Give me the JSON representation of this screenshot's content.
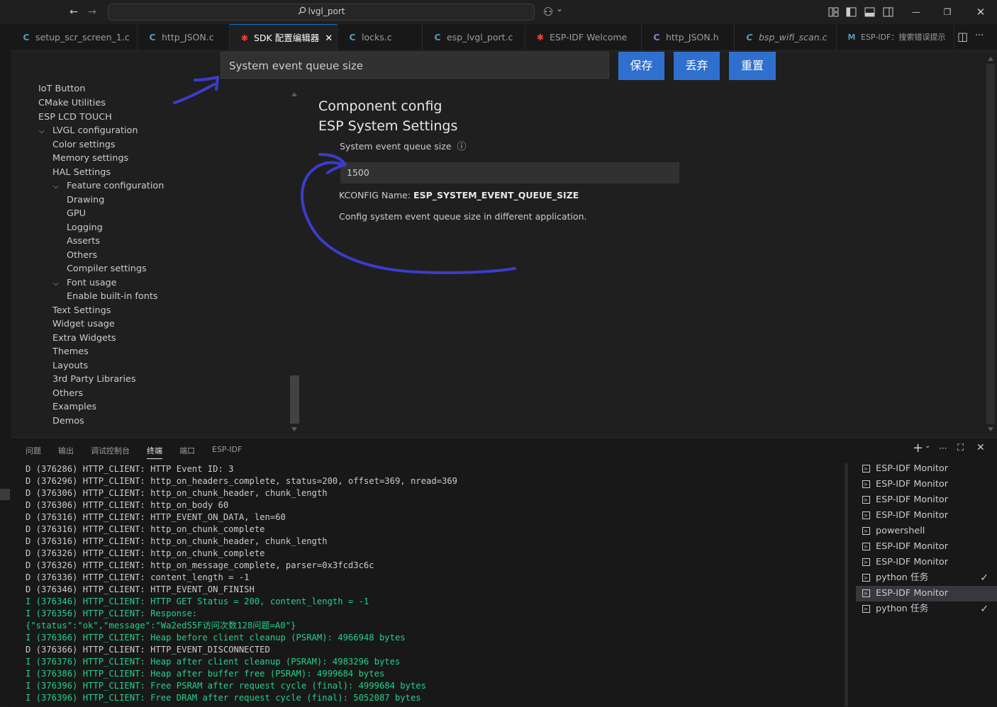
{
  "titlebar": {
    "back": "←",
    "forward": "→",
    "search_text": "lvgl_port",
    "copilot": "⚇",
    "copilot_chevron": "⌄",
    "minimize": "—",
    "restore": "❐",
    "close": "✕"
  },
  "tabs": [
    {
      "icon": "C",
      "label": "setup_scr_screen_1.c",
      "kind": "c"
    },
    {
      "icon": "C",
      "label": "http_JSON.c",
      "kind": "c"
    },
    {
      "icon": "✱",
      "label": "SDK 配置编辑器",
      "kind": "esp",
      "active": true,
      "close": "✕"
    },
    {
      "icon": "C",
      "label": "locks.c",
      "kind": "c"
    },
    {
      "icon": "C",
      "label": "esp_lvgl_port.c",
      "kind": "c"
    },
    {
      "icon": "✱",
      "label": "ESP-IDF Welcome",
      "kind": "esp"
    },
    {
      "icon": "C",
      "label": "http_JSON.h",
      "kind": "h"
    },
    {
      "icon": "C",
      "label": "bsp_wifi_scan.c",
      "kind": "c"
    },
    {
      "icon": "M",
      "label": "ESP-IDF：搜索错误提示",
      "kind": "m"
    }
  ],
  "tab_actions": {
    "split": "◫",
    "more": "···"
  },
  "config": {
    "search_value": "System event queue size",
    "buttons": {
      "save": "保存",
      "discard": "丢弃",
      "reset": "重置"
    },
    "tree": [
      {
        "label": "IoT Button",
        "indent": 0
      },
      {
        "label": "CMake Utilities",
        "indent": 0
      },
      {
        "label": "ESP LCD TOUCH",
        "indent": 0
      },
      {
        "label": "LVGL configuration",
        "indent": 1,
        "expanded": true
      },
      {
        "label": "Color settings",
        "indent": 1
      },
      {
        "label": "Memory settings",
        "indent": 1
      },
      {
        "label": "HAL Settings",
        "indent": 1
      },
      {
        "label": "Feature configuration",
        "indent": 2,
        "expanded": true
      },
      {
        "label": "Drawing",
        "indent": 2
      },
      {
        "label": "GPU",
        "indent": 2
      },
      {
        "label": "Logging",
        "indent": 2
      },
      {
        "label": "Asserts",
        "indent": 2
      },
      {
        "label": "Others",
        "indent": 2
      },
      {
        "label": "Compiler settings",
        "indent": 2
      },
      {
        "label": "Font usage",
        "indent": 2,
        "expanded": true
      },
      {
        "label": "Enable built-in fonts",
        "indent": 2
      },
      {
        "label": "Text Settings",
        "indent": 1
      },
      {
        "label": "Widget usage",
        "indent": 1
      },
      {
        "label": "Extra Widgets",
        "indent": 1
      },
      {
        "label": "Themes",
        "indent": 1
      },
      {
        "label": "Layouts",
        "indent": 1
      },
      {
        "label": "3rd Party Libraries",
        "indent": 1
      },
      {
        "label": "Others",
        "indent": 1
      },
      {
        "label": "Examples",
        "indent": 1
      },
      {
        "label": "Demos",
        "indent": 1
      }
    ],
    "chevron": "⌵",
    "section1": "Component config",
    "section2": "ESP System Settings",
    "option_label": "System event queue size",
    "info_icon": "ⓘ",
    "option_value": "1500",
    "kconfig_prefix": "KCONFIG Name: ",
    "kconfig_name": "ESP_SYSTEM_EVENT_QUEUE_SIZE",
    "description": "Config system event queue size in different application."
  },
  "panel": {
    "tabs": [
      "问题",
      "输出",
      "调试控制台",
      "终端",
      "端口",
      "ESP-IDF"
    ],
    "active_tab": "终端",
    "actions": {
      "add": "+",
      "add_chevron": "⌄",
      "more": "···",
      "maximize": "⛶",
      "close": "✕"
    },
    "terminal_lines": [
      {
        "lv": "D",
        "text": "D (376286) HTTP_CLIENT: HTTP Event ID: 3"
      },
      {
        "lv": "D",
        "text": "D (376296) HTTP_CLIENT: http_on_headers_complete, status=200, offset=369, nread=369"
      },
      {
        "lv": "D",
        "text": "D (376306) HTTP_CLIENT: http_on_chunk_header, chunk_length"
      },
      {
        "lv": "D",
        "text": "D (376306) HTTP_CLIENT: http_on_body 60"
      },
      {
        "lv": "D",
        "text": "D (376316) HTTP_CLIENT: HTTP_EVENT_ON_DATA, len=60"
      },
      {
        "lv": "D",
        "text": "D (376316) HTTP_CLIENT: http_on_chunk_complete"
      },
      {
        "lv": "D",
        "text": "D (376316) HTTP_CLIENT: http_on_chunk_header, chunk_length"
      },
      {
        "lv": "D",
        "text": "D (376326) HTTP_CLIENT: http_on_chunk_complete"
      },
      {
        "lv": "D",
        "text": "D (376326) HTTP_CLIENT: http_on_message_complete, parser=0x3fcd3c6c"
      },
      {
        "lv": "D",
        "text": "D (376336) HTTP_CLIENT: content_length = -1"
      },
      {
        "lv": "D",
        "text": "D (376346) HTTP_CLIENT: HTTP_EVENT_ON_FINISH"
      },
      {
        "lv": "I",
        "text": "I (376346) HTTP_CLIENT: HTTP GET Status = 200, content_length = -1"
      },
      {
        "lv": "I",
        "text": "I (376356) HTTP_CLIENT: Response:"
      },
      {
        "lv": "I",
        "text": "{\"status\":\"ok\",\"message\":\"Wa2edS5F访问次数128问题=A0\"}"
      },
      {
        "lv": "I",
        "text": "I (376366) HTTP_CLIENT: Heap before client cleanup (PSRAM): 4966948 bytes"
      },
      {
        "lv": "D",
        "text": "D (376366) HTTP_CLIENT: HTTP_EVENT_DISCONNECTED"
      },
      {
        "lv": "I",
        "text": "I (376376) HTTP_CLIENT: Heap after client cleanup (PSRAM): 4983296 bytes"
      },
      {
        "lv": "I",
        "text": "I (376386) HTTP_CLIENT: Heap after buffer free (PSRAM): 4999684 bytes"
      },
      {
        "lv": "I",
        "text": "I (376396) HTTP_CLIENT: Free PSRAM after request cycle (final): 4999684 bytes"
      },
      {
        "lv": "I",
        "text": "I (376396) HTTP_CLIENT: Free DRAM after request cycle (final): 5052087 bytes"
      }
    ],
    "terminals": [
      {
        "label": "ESP-IDF Monitor"
      },
      {
        "label": "ESP-IDF Monitor"
      },
      {
        "label": "ESP-IDF Monitor"
      },
      {
        "label": "ESP-IDF Monitor"
      },
      {
        "label": "powershell"
      },
      {
        "label": "ESP-IDF Monitor"
      },
      {
        "label": "ESP-IDF Monitor"
      },
      {
        "label": "python 任务",
        "check": "✓"
      },
      {
        "label": "ESP-IDF Monitor",
        "selected": true
      },
      {
        "label": "python 任务",
        "check": "✓"
      }
    ]
  },
  "colors": {
    "button_blue": "#2f6fce",
    "annotation_pen": "#3b3dcc",
    "info_log_green": "#23d18b"
  }
}
